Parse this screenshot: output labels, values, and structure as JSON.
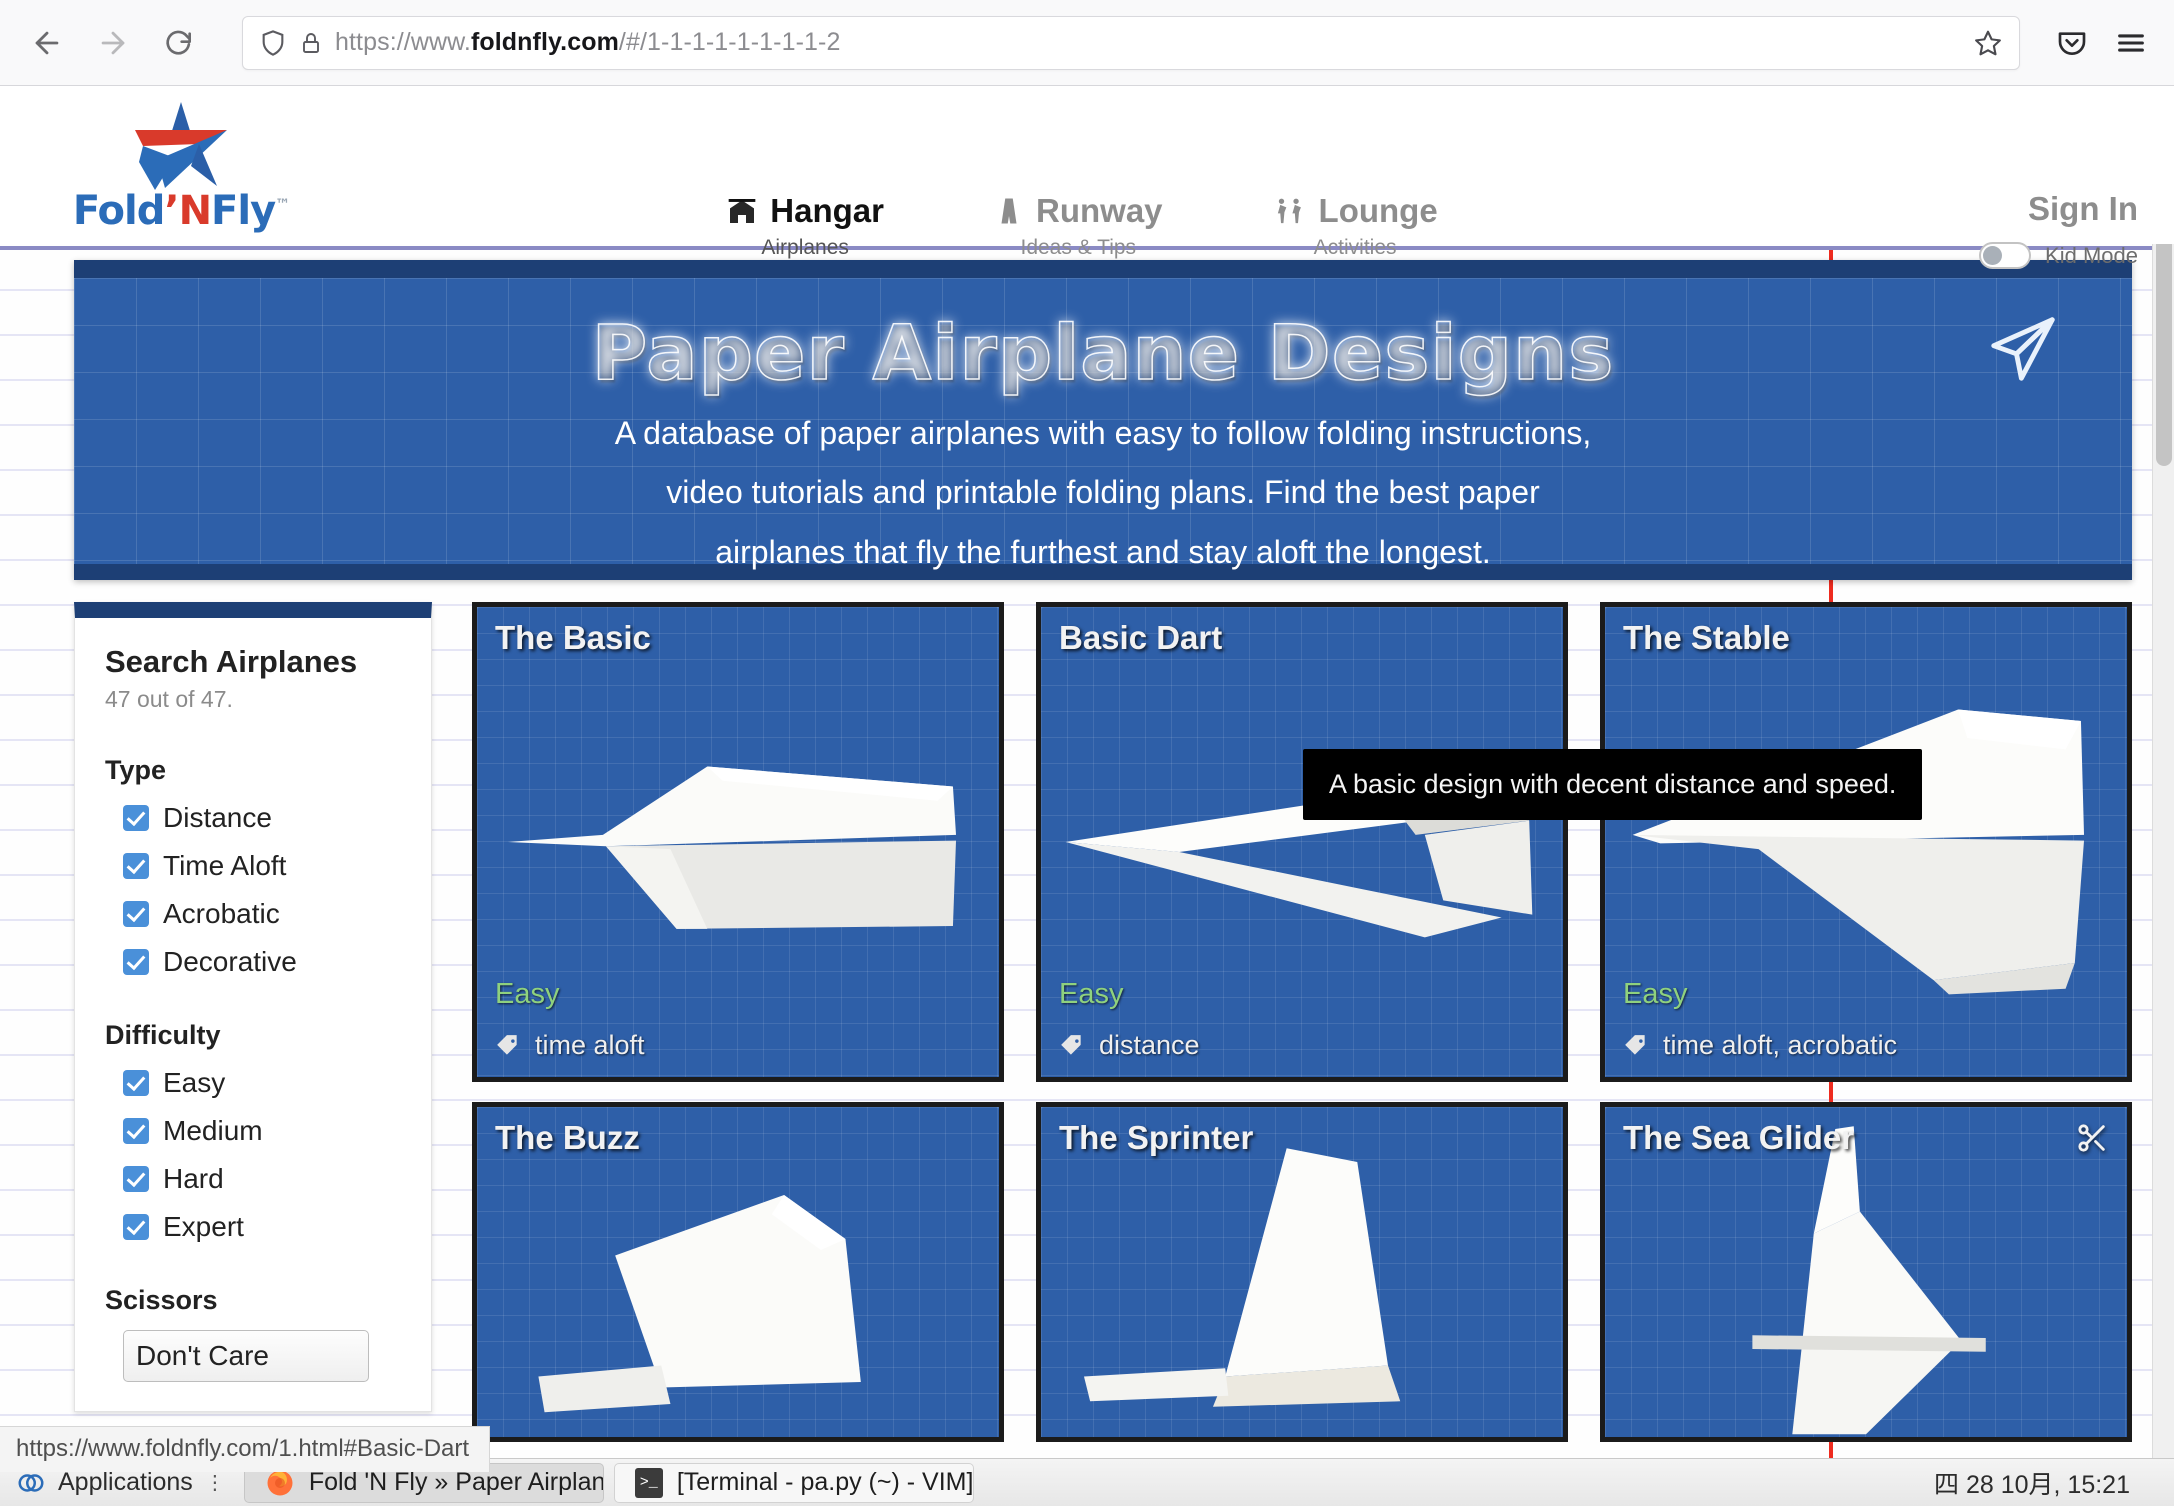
{
  "browser": {
    "url_prefix": "https://www.",
    "url_domain": "foldnfly.com",
    "url_suffix": "/#/1-1-1-1-1-1-1-1-2",
    "back_icon": "back-arrow-icon",
    "forward_icon": "forward-arrow-icon",
    "reload_icon": "reload-icon",
    "shield_icon": "shield-icon",
    "lock_icon": "padlock-icon",
    "bookmark_icon": "star-icon",
    "pocket_icon": "pocket-icon",
    "menu_icon": "hamburger-menu-icon"
  },
  "site": {
    "logo_fold": "Fold",
    "logo_apos": "’",
    "logo_n": "N",
    "logo_fly": "Fly",
    "logo_tm": "™",
    "nav": [
      {
        "label": "Hangar",
        "sub": "Airplanes",
        "icon": "hangar-icon",
        "active": true
      },
      {
        "label": "Runway",
        "sub": "Ideas & Tips",
        "icon": "runway-icon",
        "active": false
      },
      {
        "label": "Lounge",
        "sub": "Activities",
        "icon": "lounge-icon",
        "active": false
      }
    ],
    "sign_in": "Sign In",
    "kid_mode_label": "Kid Mode",
    "kid_mode_on": false
  },
  "hero": {
    "title": "Paper Airplane Designs",
    "line1": "A database of paper airplanes with easy to follow folding instructions,",
    "line2": "video tutorials and printable folding plans. Find the best paper",
    "line3": "airplanes that fly the furthest and stay aloft the longest.",
    "plane_icon": "paper-plane-icon",
    "bg_color": "#2e5fa8",
    "border_color": "#1d3f75"
  },
  "sidebar": {
    "title": "Search Airplanes",
    "count": "47 out of 47.",
    "groups": [
      {
        "name": "Type",
        "options": [
          {
            "label": "Distance",
            "checked": true
          },
          {
            "label": "Time Aloft",
            "checked": true
          },
          {
            "label": "Acrobatic",
            "checked": true
          },
          {
            "label": "Decorative",
            "checked": true
          }
        ]
      },
      {
        "name": "Difficulty",
        "options": [
          {
            "label": "Easy",
            "checked": true
          },
          {
            "label": "Medium",
            "checked": true
          },
          {
            "label": "Hard",
            "checked": true
          },
          {
            "label": "Expert",
            "checked": true
          }
        ]
      }
    ],
    "scissors_label": "Scissors",
    "scissors_value": "Don't Care",
    "checkbox_color": "#4a90d9"
  },
  "cards": [
    {
      "title": "The Basic",
      "difficulty": "Easy",
      "tags": "time aloft",
      "scissors": false,
      "art": "basic"
    },
    {
      "title": "Basic Dart",
      "difficulty": "Easy",
      "tags": "distance",
      "scissors": false,
      "art": "dart"
    },
    {
      "title": "The Stable",
      "difficulty": "Easy",
      "tags": "time aloft, acrobatic",
      "scissors": false,
      "art": "stable"
    },
    {
      "title": "The Buzz",
      "difficulty": "",
      "tags": "",
      "scissors": false,
      "art": "buzz"
    },
    {
      "title": "The Sprinter",
      "difficulty": "",
      "tags": "",
      "scissors": false,
      "art": "sprinter"
    },
    {
      "title": "The Sea Glider",
      "difficulty": "",
      "tags": "",
      "scissors": true,
      "art": "seaglider"
    }
  ],
  "tooltip": {
    "text": "A basic design with decent distance and speed."
  },
  "status_link": {
    "text": "https://www.foldnfly.com/1.html#Basic-Dart"
  },
  "taskbar": {
    "applications": "Applications",
    "windows": [
      {
        "label": "Fold 'N Fly » Paper Airplane···",
        "icon": "firefox-icon",
        "active": true
      },
      {
        "label": "[Terminal - pa.py (~) - VIM]",
        "icon": "terminal-icon",
        "active": false
      }
    ],
    "clock": "四 28 10月, 15:21"
  }
}
